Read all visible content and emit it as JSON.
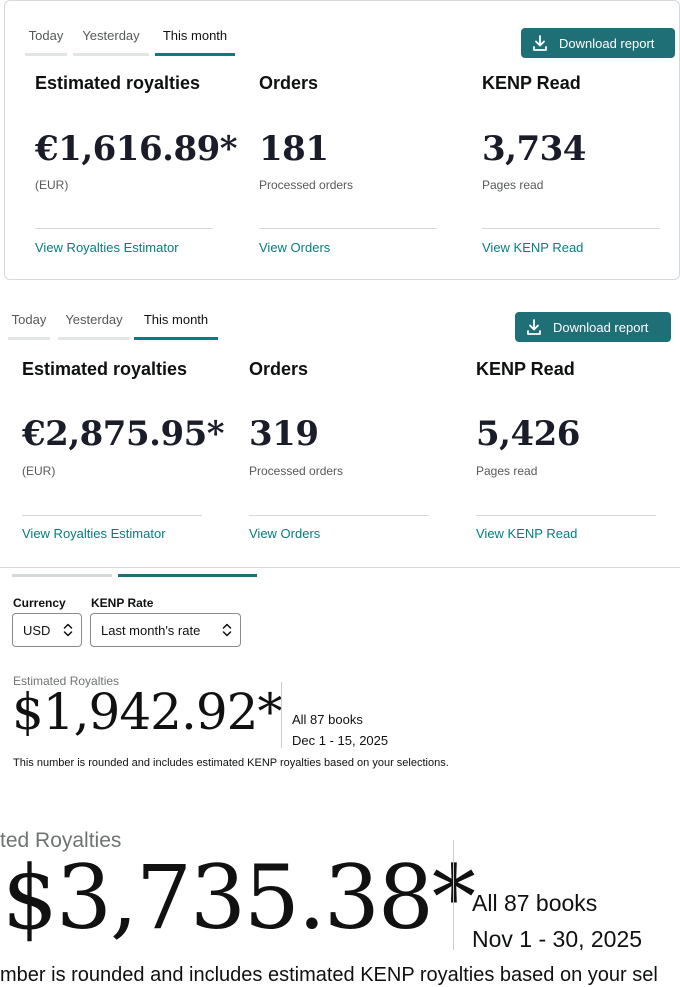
{
  "panel_a": {
    "tabs": [
      "Today",
      "Yesterday",
      "This month"
    ],
    "download_label": "Download report",
    "metrics": [
      {
        "title": "Estimated royalties",
        "value": "€1,616.89*",
        "sub": "(EUR)",
        "link": "View Royalties Estimator"
      },
      {
        "title": "Orders",
        "value": "181",
        "sub": "Processed orders",
        "link": "View Orders"
      },
      {
        "title": "KENP Read",
        "value": "3,734",
        "sub": "Pages read",
        "link": "View KENP Read"
      }
    ]
  },
  "panel_b": {
    "tabs": [
      "Today",
      "Yesterday",
      "This month"
    ],
    "download_label": "Download report",
    "metrics": [
      {
        "title": "Estimated royalties",
        "value": "€2,875.95*",
        "sub": "(EUR)",
        "link": "View Royalties Estimator"
      },
      {
        "title": "Orders",
        "value": "319",
        "sub": "Processed orders",
        "link": "View Orders"
      },
      {
        "title": "KENP Read",
        "value": "5,426",
        "sub": "Pages read",
        "link": "View KENP Read"
      }
    ]
  },
  "estimator_small": {
    "currency_label": "Currency",
    "currency_value": "USD",
    "kenp_label": "KENP Rate",
    "kenp_value": "Last month's rate",
    "heading": "Estimated Royalties",
    "amount": "$1,942.92*",
    "books": "All 87 books",
    "dates": "Dec 1 - 15, 2025",
    "note": "This number is rounded and includes estimated KENP royalties based on your selections."
  },
  "estimator_large": {
    "heading": "ted Royalties",
    "amount": "$3,735.38*",
    "books": "All 87 books",
    "dates": "Nov 1 - 30, 2025",
    "note": "mber is rounded and includes estimated KENP royalties based on your sel"
  },
  "colors": {
    "accent": "#067d81",
    "button": "#1f6f76"
  },
  "icons": {
    "download": "download-icon",
    "stepper": "up-down-chevron-icon"
  }
}
